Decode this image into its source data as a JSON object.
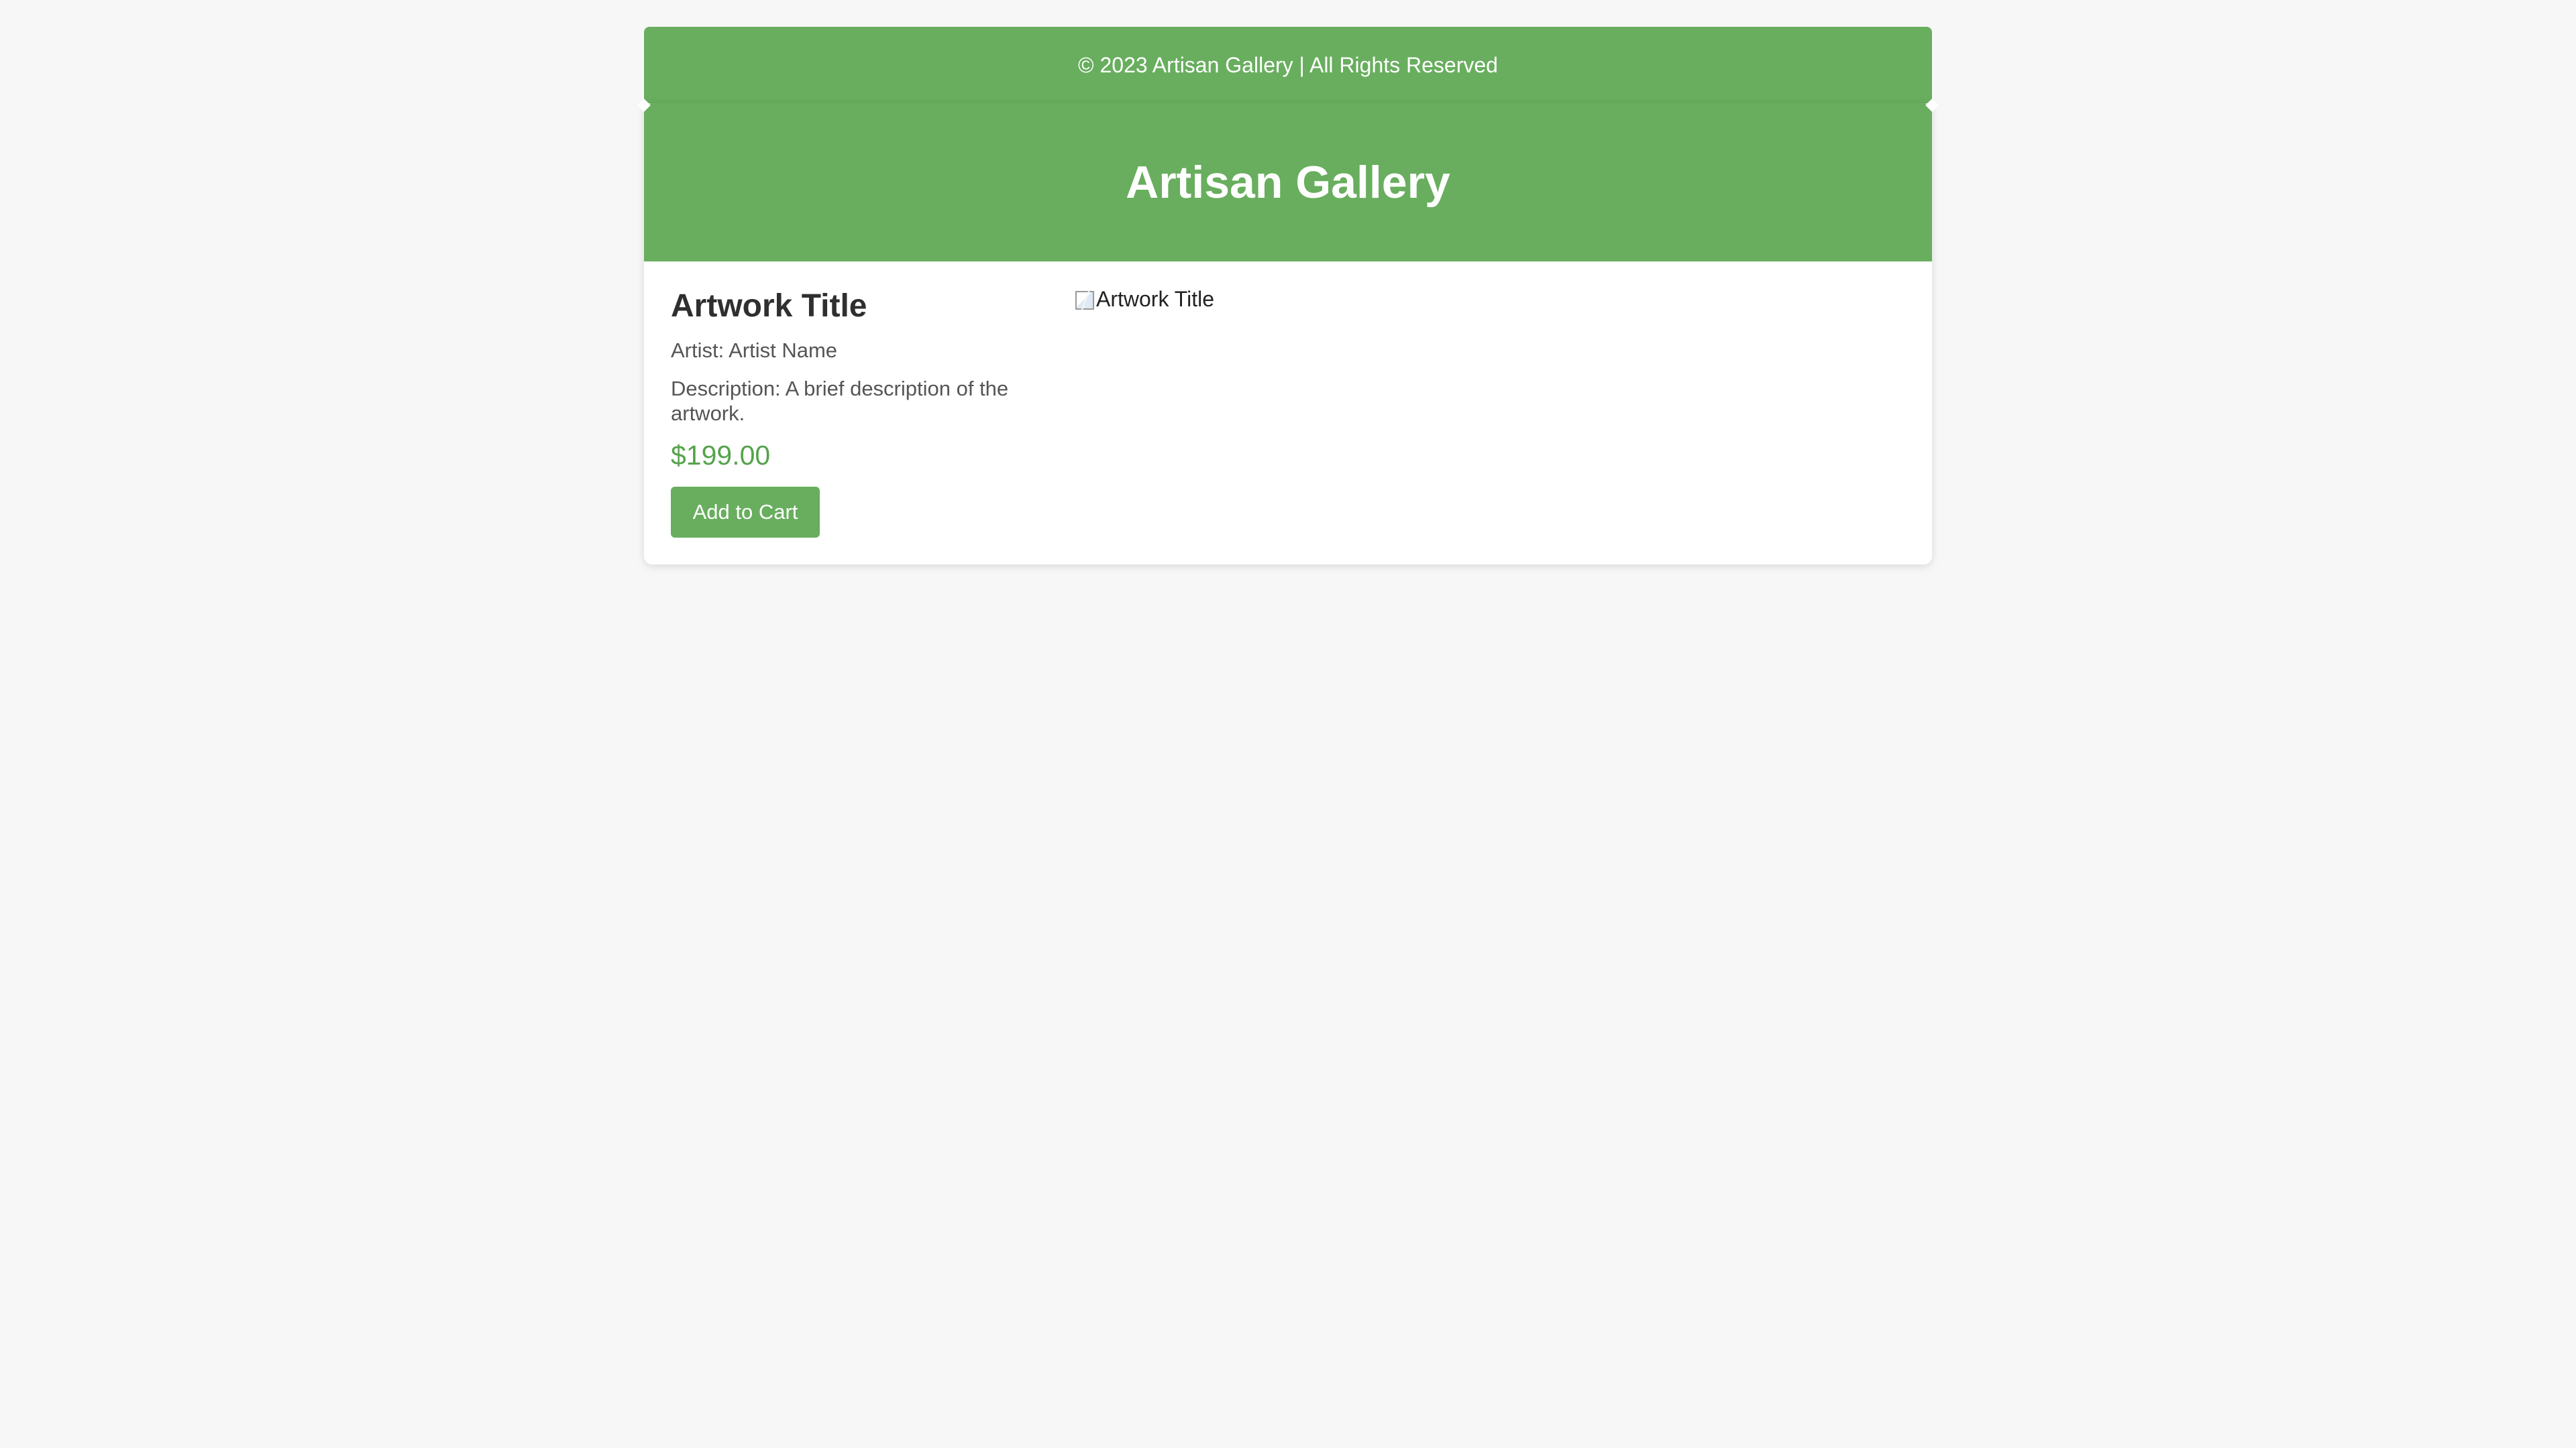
{
  "footer": {
    "copyright": "© 2023 Artisan Gallery | All Rights Reserved"
  },
  "header": {
    "title": "Artisan Gallery"
  },
  "artwork": {
    "title": "Artwork Title",
    "artist": "Artist: Artist Name",
    "description": "Description: A brief description of the artwork.",
    "price": "$199.00",
    "button_label": "Add to Cart",
    "image_alt": "Artwork Title",
    "image_icon": "broken-image-icon"
  },
  "colors": {
    "accent": "#68ae5e",
    "price": "#56a34c",
    "background": "#f7f7f7",
    "text": "#555555"
  }
}
